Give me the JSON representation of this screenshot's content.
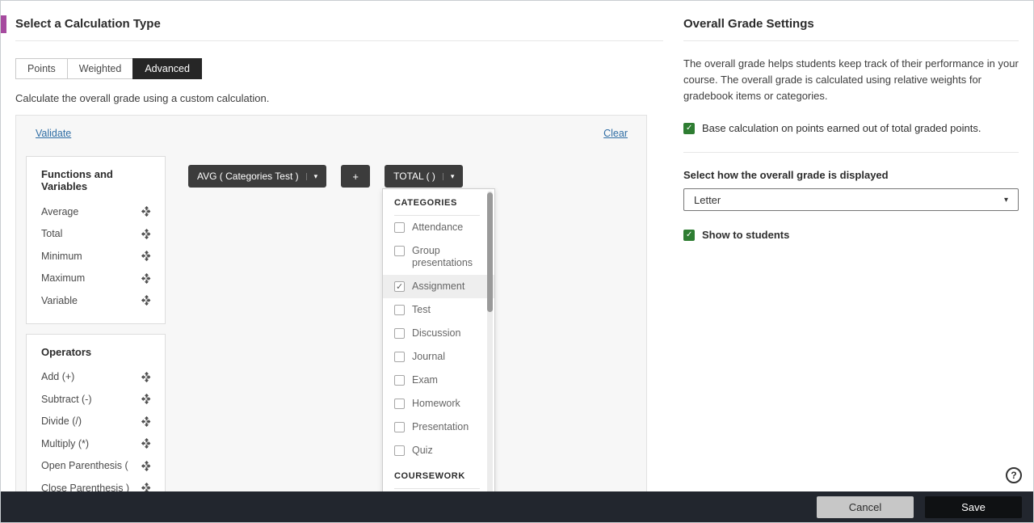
{
  "colors": {
    "accent_purple": "#a64b9f",
    "checkbox_green": "#2e7d32",
    "link_blue": "#2f6da4",
    "selected_tab_bg": "#262626",
    "pill_bg": "#3c3c3c",
    "footer_bg": "#22262e"
  },
  "icons": {
    "caret_down": "▾",
    "help": "?",
    "move": "four-way-arrow"
  },
  "left_panel": {
    "title": "Select a Calculation Type",
    "tabs": [
      {
        "label": "Points",
        "selected": false
      },
      {
        "label": "Weighted",
        "selected": false
      },
      {
        "label": "Advanced",
        "selected": true
      }
    ],
    "description": "Calculate the overall grade using a custom calculation.",
    "validate_label": "Validate",
    "clear_label": "Clear",
    "functions_card": {
      "title": "Functions and Variables",
      "items": [
        "Average",
        "Total",
        "Minimum",
        "Maximum",
        "Variable"
      ]
    },
    "operators_card": {
      "title": "Operators",
      "items": [
        "Add (+)",
        "Subtract (-)",
        "Divide (/)",
        "Multiply (*)",
        "Open Parenthesis (",
        "Close Parenthesis )"
      ]
    },
    "canvas": {
      "pills": [
        {
          "label": "AVG ( Categories Test )",
          "type": "dropdown"
        },
        {
          "label": "+",
          "type": "operator"
        },
        {
          "label": "TOTAL ( )",
          "type": "dropdown"
        }
      ],
      "dropdown": {
        "sections": [
          {
            "header": "CATEGORIES",
            "items": [
              {
                "label": "Attendance",
                "checked": false
              },
              {
                "label": "Group presentations",
                "checked": false
              },
              {
                "label": "Assignment",
                "checked": true
              },
              {
                "label": "Test",
                "checked": false
              },
              {
                "label": "Discussion",
                "checked": false
              },
              {
                "label": "Journal",
                "checked": false
              },
              {
                "label": "Exam",
                "checked": false
              },
              {
                "label": "Homework",
                "checked": false
              },
              {
                "label": "Presentation",
                "checked": false
              },
              {
                "label": "Quiz",
                "checked": false
              }
            ]
          },
          {
            "header": "COURSEWORK",
            "items": []
          }
        ]
      }
    }
  },
  "right_panel": {
    "title": "Overall Grade Settings",
    "description": "The overall grade helps students keep track of their performance in your course. The overall grade is calculated using relative weights for gradebook items or categories.",
    "base_calc_checkbox": {
      "label": "Base calculation on points earned out of total graded points.",
      "checked": true
    },
    "display_label": "Select how the overall grade is displayed",
    "display_select": {
      "value": "Letter"
    },
    "show_students_checkbox": {
      "label": "Show to students",
      "checked": true
    }
  },
  "footer": {
    "cancel_label": "Cancel",
    "save_label": "Save"
  }
}
